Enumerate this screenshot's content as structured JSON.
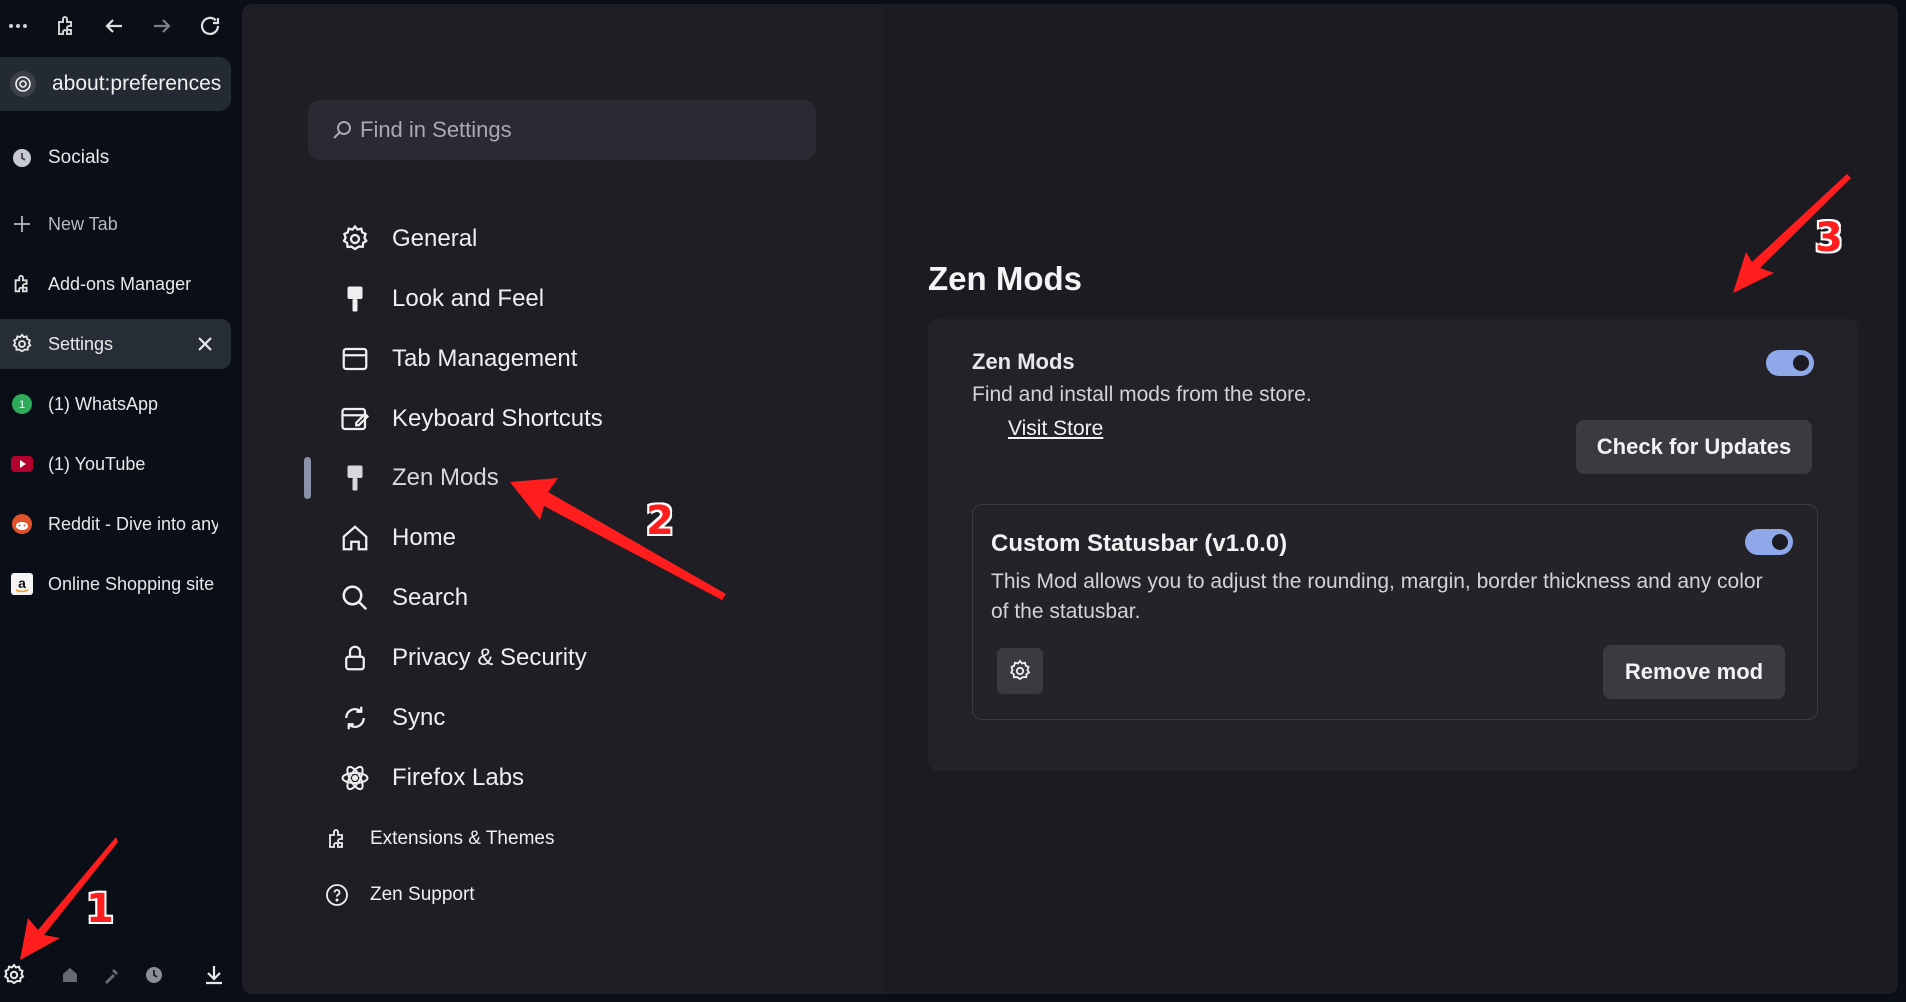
{
  "browser": {
    "url": "about:preferences",
    "tabs": [
      {
        "label": "Socials",
        "icon": "clock-icon"
      },
      {
        "label": "New Tab",
        "icon": "plus-icon"
      },
      {
        "label": "Add-ons Manager",
        "icon": "puzzle-icon"
      },
      {
        "label": "Settings",
        "icon": "gear-icon",
        "active": true
      },
      {
        "label": "(1) WhatsApp",
        "icon": "whatsapp-icon"
      },
      {
        "label": "(1) YouTube",
        "icon": "youtube-icon"
      },
      {
        "label": "Reddit - Dive into anything",
        "icon": "reddit-icon"
      },
      {
        "label": "Online Shopping site",
        "icon": "amazon-icon"
      }
    ]
  },
  "settings": {
    "search_placeholder": "Find in Settings",
    "categories": [
      {
        "label": "General",
        "icon": "gear-icon"
      },
      {
        "label": "Look and Feel",
        "icon": "paintbrush-icon"
      },
      {
        "label": "Tab Management",
        "icon": "window-icon"
      },
      {
        "label": "Keyboard Shortcuts",
        "icon": "keyboard-icon"
      },
      {
        "label": "Zen Mods",
        "icon": "paintbrush-icon",
        "selected": true
      },
      {
        "label": "Home",
        "icon": "home-icon"
      },
      {
        "label": "Search",
        "icon": "magnifier-icon"
      },
      {
        "label": "Privacy & Security",
        "icon": "lock-icon"
      },
      {
        "label": "Sync",
        "icon": "sync-icon"
      },
      {
        "label": "Firefox Labs",
        "icon": "atom-icon"
      }
    ],
    "footer_links": [
      {
        "label": "Extensions & Themes",
        "icon": "puzzle-icon"
      },
      {
        "label": "Zen Support",
        "icon": "help-icon"
      }
    ]
  },
  "page": {
    "title": "Zen Mods",
    "section_heading": "Zen Mods",
    "section_description": "Find and install mods from the store.",
    "visit_store": "Visit Store",
    "check_updates": "Check for Updates",
    "zen_mods_enabled": true,
    "mod": {
      "name": "Custom Statusbar (v1.0.0)",
      "description": "This Mod allows you to adjust the rounding, margin, border thickness and any color of the statusbar.",
      "remove_label": "Remove mod",
      "enabled": true
    }
  },
  "annotations": {
    "step1": "1",
    "step2": "2",
    "step3": "3"
  },
  "colors": {
    "accent": "#8ea8ea",
    "annotation": "#ff1d1d",
    "sidebar_bg": "#0a0f17"
  }
}
